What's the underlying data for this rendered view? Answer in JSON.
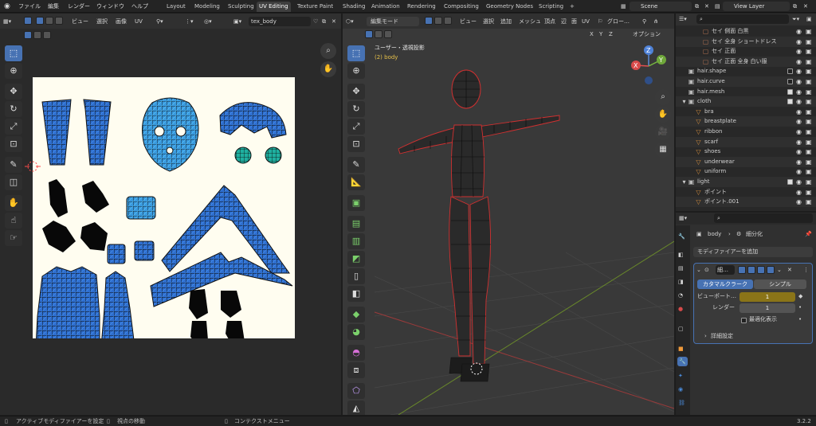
{
  "menu": {
    "items": [
      "ファイル",
      "編集",
      "レンダー",
      "ウィンドウ",
      "ヘルプ"
    ],
    "workspaces": [
      "Layout",
      "Modeling",
      "Sculpting",
      "UV Editing",
      "Texture Paint",
      "Shading",
      "Animation",
      "Rendering",
      "Compositing",
      "Geometry Nodes",
      "Scripting"
    ],
    "active_workspace": "UV Editing",
    "add_tab": "+",
    "scene": "Scene",
    "view_layer": "View Layer"
  },
  "uv_editor": {
    "menu": [
      "ビュー",
      "選択",
      "画像",
      "UV"
    ],
    "image_name": "tex_body"
  },
  "viewport": {
    "mode": "編集モード",
    "menu": [
      "ビュー",
      "選択",
      "追加",
      "メッシュ",
      "頂点",
      "辺",
      "面",
      "UV"
    ],
    "transform": "グロー…",
    "axes": [
      "X",
      "Y",
      "Z"
    ],
    "options": "オプション",
    "view_title": "ユーザー・透視投影",
    "object_label": "(2) body",
    "gizmo": {
      "x": "X",
      "y": "Y",
      "z": "Z"
    }
  },
  "outliner": {
    "rows": [
      {
        "name": "セイ 側面 白黒",
        "indent": 3,
        "color": "#b07050",
        "camera": true
      },
      {
        "name": "セイ 全身 ショートドレス",
        "indent": 3,
        "color": "#b07050",
        "camera": true
      },
      {
        "name": "セイ 正面",
        "indent": 3,
        "color": "#b07050",
        "camera": true
      },
      {
        "name": "セイ 正面 全身 白い服",
        "indent": 3,
        "color": "#b07050",
        "camera": true
      },
      {
        "name": "hair.shape",
        "indent": 1,
        "color": "#bbbbbb",
        "check": false
      },
      {
        "name": "hair.curve",
        "indent": 1,
        "color": "#bbbbbb",
        "check": false
      },
      {
        "name": "hair.mesh",
        "indent": 1,
        "color": "#bbbbbb",
        "check": true
      },
      {
        "name": "cloth",
        "indent": 1,
        "color": "#bbbbbb",
        "check": true,
        "expand": true
      },
      {
        "name": "bra",
        "indent": 2,
        "color": "#d08a3c"
      },
      {
        "name": "breastplate",
        "indent": 2,
        "color": "#d08a3c"
      },
      {
        "name": "ribbon",
        "indent": 2,
        "color": "#d08a3c"
      },
      {
        "name": "scarf",
        "indent": 2,
        "color": "#d08a3c"
      },
      {
        "name": "shoes",
        "indent": 2,
        "color": "#d08a3c"
      },
      {
        "name": "underwear",
        "indent": 2,
        "color": "#d08a3c"
      },
      {
        "name": "uniform",
        "indent": 2,
        "color": "#d08a3c"
      },
      {
        "name": "light",
        "indent": 1,
        "color": "#bbbbbb",
        "check": true,
        "expand": true
      },
      {
        "name": "ポイント",
        "indent": 2,
        "color": "#d08a3c"
      },
      {
        "name": "ポイント.001",
        "indent": 2,
        "color": "#d08a3c"
      }
    ]
  },
  "properties": {
    "breadcrumb_object": "body",
    "breadcrumb_sep": "›",
    "breadcrumb_modifier": "細分化",
    "add_modifier": "モディファイアーを追加",
    "modifier_name": "細…",
    "tab_catmull": "カタマルクラーク",
    "tab_simple": "シンプル",
    "viewport_label": "ビューポート…",
    "viewport_value": "1",
    "render_label": "レンダー",
    "render_value": "1",
    "optimal_label": "最適化表示",
    "advanced_label": "詳細設定"
  },
  "status": {
    "left": "アクティブモディファイアーを設定",
    "mid": "視点の移動",
    "right": "コンテクストメニュー",
    "version": "3.2.2"
  }
}
